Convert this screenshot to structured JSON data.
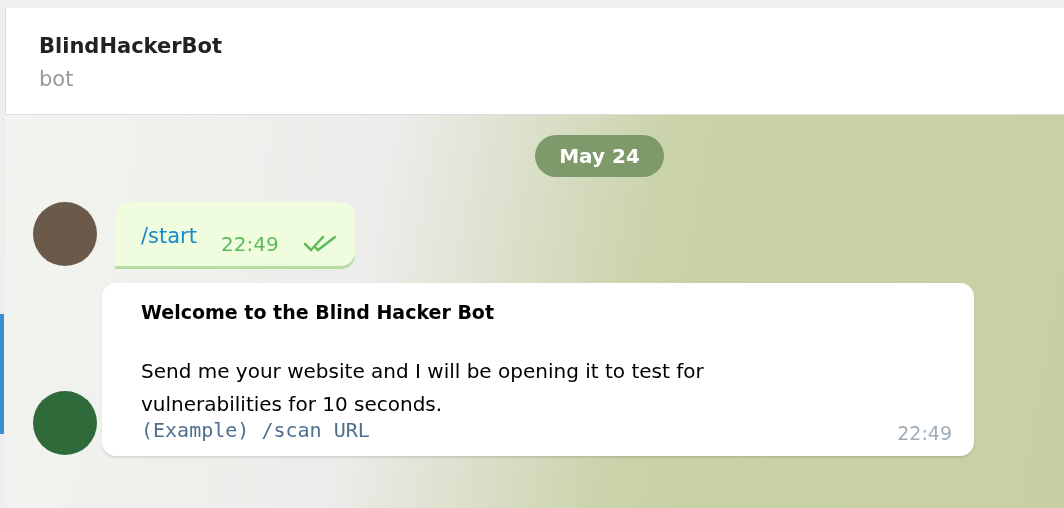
{
  "chat": {
    "title": "BlindHackerBot",
    "subtitle": "bot"
  },
  "date_badge": "May 24",
  "messages": [
    {
      "kind": "command",
      "text": "/start",
      "time": "22:49",
      "read": true
    },
    {
      "kind": "bot",
      "title": "Welcome to the Blind Hacker Bot",
      "text": "Send me your website and I will be opening it to test for vulnerabilities for 10 seconds.",
      "code": "(Example) /scan URL",
      "time": "22:49"
    }
  ]
}
